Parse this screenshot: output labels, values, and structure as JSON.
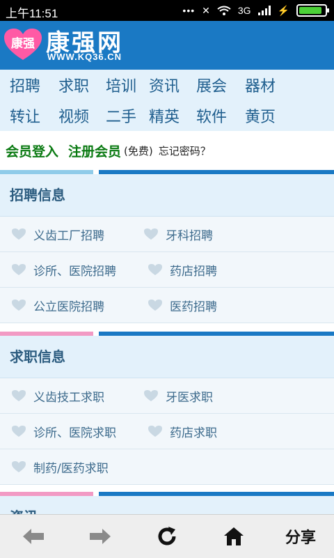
{
  "status_bar": {
    "time": "上午11:51",
    "network": "3G"
  },
  "header": {
    "logo_badge_text": "康强",
    "logo_text": "康强网",
    "logo_url": "WWW.KQ36.CN"
  },
  "categories": {
    "row1": [
      "招聘",
      "求职",
      "培训",
      "资讯",
      "展会",
      "器材"
    ],
    "row2": [
      "转让",
      "视频",
      "二手",
      "精英",
      "软件",
      "黄页"
    ]
  },
  "login": {
    "member_login": "会员登入",
    "register": "注册会员",
    "free": "(免费)",
    "forgot": "忘记密码？"
  },
  "sections": [
    {
      "title": "招聘信息",
      "accent": "#8fcbe9",
      "rows": [
        [
          "义齿工厂招聘",
          "牙科招聘"
        ],
        [
          "诊所、医院招聘",
          "药店招聘"
        ],
        [
          "公立医院招聘",
          "医药招聘"
        ]
      ]
    },
    {
      "title": "求职信息",
      "accent": "#f29ac4",
      "rows": [
        [
          "义齿技工求职",
          "牙医求职"
        ],
        [
          "诊所、医院求职",
          "药店求职"
        ],
        [
          "制药/医药求职",
          ""
        ]
      ]
    }
  ],
  "next_section_peek": "资讯",
  "toolbar": {
    "icons": [
      "back-arrow-icon",
      "forward-arrow-icon",
      "refresh-icon",
      "home-icon"
    ],
    "share_label": "分享"
  },
  "colors": {
    "brand_blue": "#1a79c4",
    "login_green": "#0a7a12",
    "heart_gray": "#c9d8e3"
  }
}
